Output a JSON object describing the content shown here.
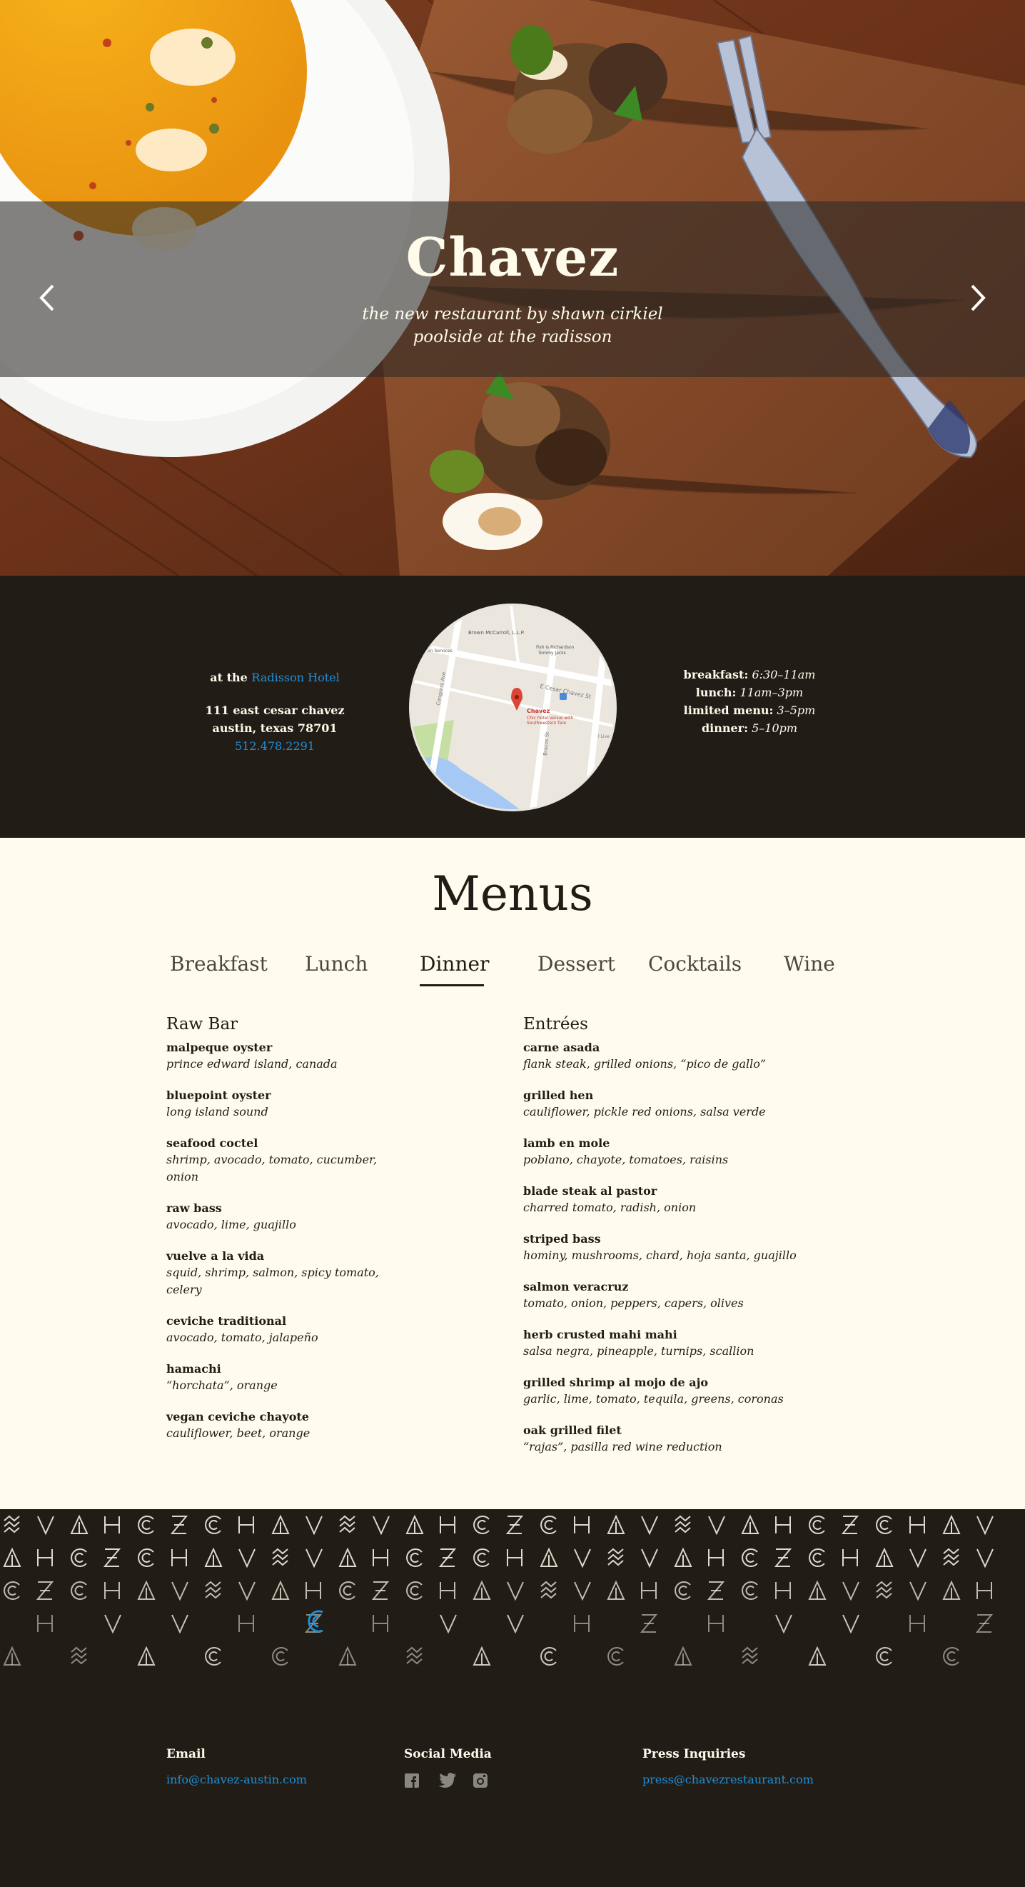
{
  "hero": {
    "title": "Chavez",
    "tagline_1": "the new restaurant by shawn cirkiel",
    "tagline_2": "poolside at the radisson",
    "prev_icon": "chevron-left-icon",
    "next_icon": "chevron-right-icon"
  },
  "info": {
    "at_prefix": "at the ",
    "hotel_link": "Radisson Hotel",
    "address_line1": "111 east cesar chavez",
    "address_line2": "austin, texas 78701",
    "phone": "512.478.2291",
    "map": {
      "label_1": "Brown McCarroll, L.L.P.",
      "label_2": "Fish & Richardson",
      "label_3": "Tommy Jacks",
      "label_4": "Buildin Services",
      "street_1": "E Cesar Chavez St",
      "street_2": "Congress Ave",
      "street_3": "Brazos St",
      "pin_name": "Chavez",
      "pin_desc_1": "Chic hotel venue with",
      "pin_desc_2": "Southwestern fare",
      "edge_label": "l Live !"
    },
    "hours": [
      {
        "label": "breakfast:",
        "value": "6:30–11am"
      },
      {
        "label": "lunch:",
        "value": "11am–3pm"
      },
      {
        "label": "limited menu:",
        "value": "3–5pm"
      },
      {
        "label": "dinner:",
        "value": "5–10pm"
      }
    ]
  },
  "menus": {
    "title": "Menus",
    "tabs": [
      "Breakfast",
      "Lunch",
      "Dinner",
      "Dessert",
      "Cocktails",
      "Wine"
    ],
    "active_tab": "Dinner",
    "raw_bar": {
      "heading": "Raw Bar",
      "items": [
        {
          "name": "malpeque oyster",
          "desc": "prince edward island, canada"
        },
        {
          "name": "bluepoint oyster",
          "desc": "long island sound"
        },
        {
          "name": "seafood coctel",
          "desc": "shrimp, avocado, tomato, cucumber, onion"
        },
        {
          "name": "raw bass",
          "desc": "avocado, lime, guajillo"
        },
        {
          "name": "vuelve a la vida",
          "desc": "squid, shrimp, salmon, spicy tomato, celery"
        },
        {
          "name": "ceviche traditional",
          "desc": "avocado, tomato, jalapeño"
        },
        {
          "name": "hamachi",
          "desc": "“horchata”, orange"
        },
        {
          "name": "vegan ceviche chayote",
          "desc": "cauliflower, beet, orange"
        }
      ]
    },
    "entrees": {
      "heading": "Entrées",
      "items": [
        {
          "name": "carne asada",
          "desc": "flank steak, grilled onions, “pico de gallo”"
        },
        {
          "name": "grilled hen",
          "desc": "cauliflower, pickle red onions, salsa verde"
        },
        {
          "name": "lamb en mole",
          "desc": "poblano, chayote, tomatoes, raisins"
        },
        {
          "name": "blade steak al pastor",
          "desc": "charred tomato, radish, onion"
        },
        {
          "name": "striped bass",
          "desc": "hominy, mushrooms, chard, hoja santa, guajillo"
        },
        {
          "name": "salmon veracruz",
          "desc": "tomato, onion, peppers, capers, olives"
        },
        {
          "name": "herb crusted mahi mahi",
          "desc": "salsa negra, pineapple, turnips, scallion"
        },
        {
          "name": "grilled shrimp al mojo de ajo",
          "desc": "garlic, lime, tomato, tequila, greens, coronas"
        },
        {
          "name": "oak grilled filet",
          "desc": "“rajas”, pasilla red wine reduction"
        }
      ]
    }
  },
  "footer": {
    "email_heading": "Email",
    "email": "info@chavez-austin.com",
    "social_heading": "Social Media",
    "social_icons": [
      "facebook-icon",
      "twitter-icon",
      "instagram-icon"
    ],
    "press_heading": "Press Inquiries",
    "press_email": "press@chavezrestaurant.com"
  },
  "colors": {
    "dark": "#221c16",
    "cream": "#fffcef",
    "link_blue": "#1e90d8"
  }
}
